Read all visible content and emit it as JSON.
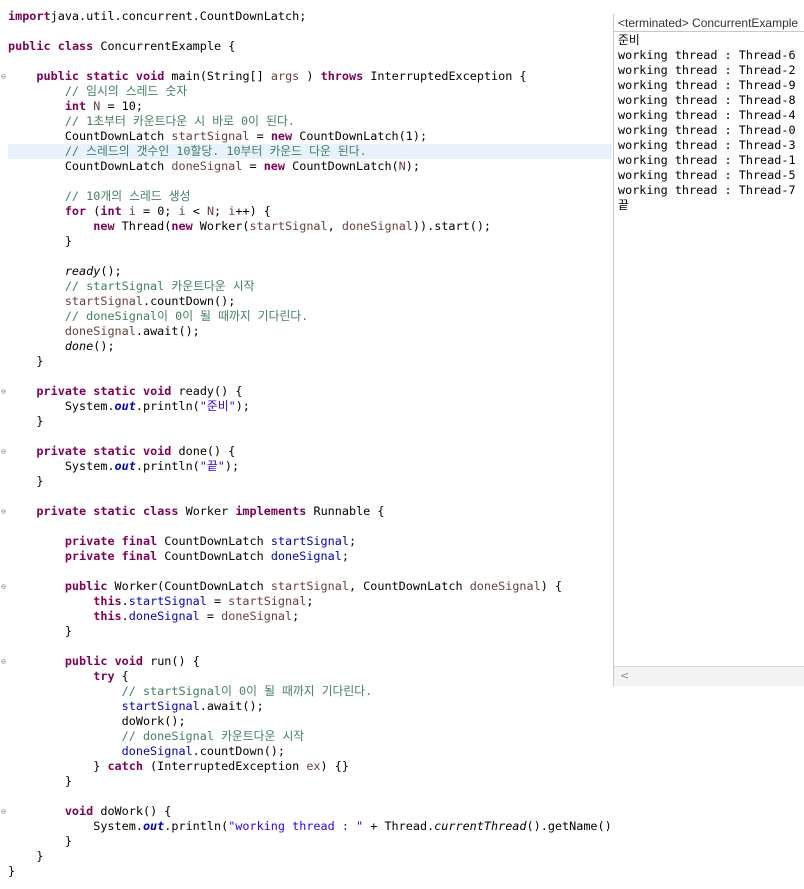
{
  "editor": {
    "lines": [
      [
        [
          "kw",
          "import"
        ],
        [
          "",
          "java.util.concurrent.CountDownLatch;"
        ]
      ],
      [],
      [
        [
          "kw",
          "public"
        ],
        [
          "",
          " "
        ],
        [
          "kw",
          "class"
        ],
        [
          "",
          " ConcurrentExample {"
        ]
      ],
      [],
      [
        [
          "",
          "    "
        ],
        [
          "kw",
          "public"
        ],
        [
          "",
          " "
        ],
        [
          "kw",
          "static"
        ],
        [
          "",
          " "
        ],
        [
          "kw",
          "void"
        ],
        [
          "",
          " main(String[] "
        ],
        [
          "lv",
          "args"
        ],
        [
          "",
          " ) "
        ],
        [
          "kw",
          "throws"
        ],
        [
          "",
          " InterruptedException {"
        ]
      ],
      [
        [
          "",
          "        "
        ],
        [
          "cm",
          "// 임시의 스레드 숫자"
        ]
      ],
      [
        [
          "",
          "        "
        ],
        [
          "kw",
          "int"
        ],
        [
          "",
          " "
        ],
        [
          "lv",
          "N"
        ],
        [
          "",
          " = 10;"
        ]
      ],
      [
        [
          "",
          "        "
        ],
        [
          "cm",
          "// 1초부터 카운트다운 시 바로 0이 된다."
        ]
      ],
      [
        [
          "",
          "        CountDownLatch "
        ],
        [
          "lv",
          "startSignal"
        ],
        [
          "",
          " = "
        ],
        [
          "kw",
          "new"
        ],
        [
          "",
          " CountDownLatch(1);"
        ]
      ],
      [
        [
          "",
          "        "
        ],
        [
          "cm",
          "// 스레드의 갯수인 10할당. 10부터 카운드 다운 된다."
        ]
      ],
      [
        [
          "",
          "        CountDownLatch "
        ],
        [
          "lv",
          "doneSignal"
        ],
        [
          "",
          " = "
        ],
        [
          "kw",
          "new"
        ],
        [
          "",
          " CountDownLatch("
        ],
        [
          "lv",
          "N"
        ],
        [
          "",
          ");"
        ]
      ],
      [],
      [
        [
          "",
          "        "
        ],
        [
          "cm",
          "// 10개의 스레드 생성"
        ]
      ],
      [
        [
          "",
          "        "
        ],
        [
          "kw",
          "for"
        ],
        [
          "",
          " ("
        ],
        [
          "kw",
          "int"
        ],
        [
          "",
          " "
        ],
        [
          "lv",
          "i"
        ],
        [
          "",
          " = 0; "
        ],
        [
          "lv",
          "i"
        ],
        [
          "",
          " < "
        ],
        [
          "lv",
          "N"
        ],
        [
          "",
          "; "
        ],
        [
          "lv",
          "i"
        ],
        [
          "",
          "++) {"
        ]
      ],
      [
        [
          "",
          "            "
        ],
        [
          "kw",
          "new"
        ],
        [
          "",
          " Thread("
        ],
        [
          "kw",
          "new"
        ],
        [
          "",
          " Worker("
        ],
        [
          "lv",
          "startSignal"
        ],
        [
          "",
          ", "
        ],
        [
          "lv",
          "doneSignal"
        ],
        [
          "",
          ")).start();"
        ]
      ],
      [
        [
          "",
          "        }"
        ]
      ],
      [],
      [
        [
          "",
          "        "
        ],
        [
          "it",
          "ready"
        ],
        [
          "",
          "();"
        ]
      ],
      [
        [
          "",
          "        "
        ],
        [
          "cm",
          "// startSignal 카운트다운 시작"
        ]
      ],
      [
        [
          "",
          "        "
        ],
        [
          "lv",
          "startSignal"
        ],
        [
          "",
          ".countDown();"
        ]
      ],
      [
        [
          "",
          "        "
        ],
        [
          "cm",
          "// doneSignal이 0이 될 때까지 기다린다."
        ]
      ],
      [
        [
          "",
          "        "
        ],
        [
          "lv",
          "doneSignal"
        ],
        [
          "",
          ".await();"
        ]
      ],
      [
        [
          "",
          "        "
        ],
        [
          "it",
          "done"
        ],
        [
          "",
          "();"
        ]
      ],
      [
        [
          "",
          "    }"
        ]
      ],
      [],
      [
        [
          "",
          "    "
        ],
        [
          "kw",
          "private"
        ],
        [
          "",
          " "
        ],
        [
          "kw",
          "static"
        ],
        [
          "",
          " "
        ],
        [
          "kw",
          "void"
        ],
        [
          "",
          " ready() {"
        ]
      ],
      [
        [
          "",
          "        System."
        ],
        [
          "sfd",
          "out"
        ],
        [
          "",
          ".println("
        ],
        [
          "st",
          "\"준비\""
        ],
        [
          "",
          ");"
        ]
      ],
      [
        [
          "",
          "    }"
        ]
      ],
      [],
      [
        [
          "",
          "    "
        ],
        [
          "kw",
          "private"
        ],
        [
          "",
          " "
        ],
        [
          "kw",
          "static"
        ],
        [
          "",
          " "
        ],
        [
          "kw",
          "void"
        ],
        [
          "",
          " done() {"
        ]
      ],
      [
        [
          "",
          "        System."
        ],
        [
          "sfd",
          "out"
        ],
        [
          "",
          ".println("
        ],
        [
          "st",
          "\"끝\""
        ],
        [
          "",
          ");"
        ]
      ],
      [
        [
          "",
          "    }"
        ]
      ],
      [],
      [
        [
          "",
          "    "
        ],
        [
          "kw",
          "private"
        ],
        [
          "",
          " "
        ],
        [
          "kw",
          "static"
        ],
        [
          "",
          " "
        ],
        [
          "kw",
          "class"
        ],
        [
          "",
          " Worker "
        ],
        [
          "kw",
          "implements"
        ],
        [
          "",
          " Runnable {"
        ]
      ],
      [],
      [
        [
          "",
          "        "
        ],
        [
          "kw",
          "private"
        ],
        [
          "",
          " "
        ],
        [
          "kw",
          "final"
        ],
        [
          "",
          " CountDownLatch "
        ],
        [
          "fd",
          "startSignal"
        ],
        [
          "",
          ";"
        ]
      ],
      [
        [
          "",
          "        "
        ],
        [
          "kw",
          "private"
        ],
        [
          "",
          " "
        ],
        [
          "kw",
          "final"
        ],
        [
          "",
          " CountDownLatch "
        ],
        [
          "fd",
          "doneSignal"
        ],
        [
          "",
          ";"
        ]
      ],
      [],
      [
        [
          "",
          "        "
        ],
        [
          "kw",
          "public"
        ],
        [
          "",
          " Worker(CountDownLatch "
        ],
        [
          "lv",
          "startSignal"
        ],
        [
          "",
          ", CountDownLatch "
        ],
        [
          "lv",
          "doneSignal"
        ],
        [
          "",
          ") {"
        ]
      ],
      [
        [
          "",
          "            "
        ],
        [
          "kw",
          "this"
        ],
        [
          "",
          "."
        ],
        [
          "fd",
          "startSignal"
        ],
        [
          "",
          " = "
        ],
        [
          "lv",
          "startSignal"
        ],
        [
          "",
          ";"
        ]
      ],
      [
        [
          "",
          "            "
        ],
        [
          "kw",
          "this"
        ],
        [
          "",
          "."
        ],
        [
          "fd",
          "doneSignal"
        ],
        [
          "",
          " = "
        ],
        [
          "lv",
          "doneSignal"
        ],
        [
          "",
          ";"
        ]
      ],
      [
        [
          "",
          "        }"
        ]
      ],
      [],
      [
        [
          "",
          "        "
        ],
        [
          "kw",
          "public"
        ],
        [
          "",
          " "
        ],
        [
          "kw",
          "void"
        ],
        [
          "",
          " run() {"
        ]
      ],
      [
        [
          "",
          "            "
        ],
        [
          "kw",
          "try"
        ],
        [
          "",
          " {"
        ]
      ],
      [
        [
          "",
          "                "
        ],
        [
          "cm",
          "// startSignal이 0이 될 때까지 기다린다."
        ]
      ],
      [
        [
          "",
          "                "
        ],
        [
          "fd",
          "startSignal"
        ],
        [
          "",
          ".await();"
        ]
      ],
      [
        [
          "",
          "                doWork();"
        ]
      ],
      [
        [
          "",
          "                "
        ],
        [
          "cm",
          "// doneSignal 카운트다운 시작"
        ]
      ],
      [
        [
          "",
          "                "
        ],
        [
          "fd",
          "doneSignal"
        ],
        [
          "",
          ".countDown();"
        ]
      ],
      [
        [
          "",
          "            } "
        ],
        [
          "kw",
          "catch"
        ],
        [
          "",
          " (InterruptedException "
        ],
        [
          "lv",
          "ex"
        ],
        [
          "",
          ") {}"
        ]
      ],
      [
        [
          "",
          "        }"
        ]
      ],
      [],
      [
        [
          "",
          "        "
        ],
        [
          "kw",
          "void"
        ],
        [
          "",
          " doWork() {"
        ]
      ],
      [
        [
          "",
          "            System."
        ],
        [
          "sfd",
          "out"
        ],
        [
          "",
          ".println("
        ],
        [
          "st",
          "\"working thread : \""
        ],
        [
          "",
          " + Thread."
        ],
        [
          "it",
          "currentThread"
        ],
        [
          "",
          "().getName());"
        ]
      ],
      [
        [
          "",
          "        }"
        ]
      ],
      [
        [
          "",
          "    }"
        ]
      ],
      [
        [
          "",
          "}"
        ]
      ]
    ],
    "highlighted_line": 9,
    "fold_markers": [
      4,
      25,
      29,
      33,
      38,
      43,
      53
    ]
  },
  "console": {
    "title": "<terminated> ConcurrentExample",
    "output": [
      "준비",
      "working thread : Thread-6",
      "working thread : Thread-2",
      "working thread : Thread-9",
      "working thread : Thread-8",
      "working thread : Thread-4",
      "working thread : Thread-0",
      "working thread : Thread-3",
      "working thread : Thread-1",
      "working thread : Thread-5",
      "working thread : Thread-7",
      "끝"
    ],
    "scroll_left_icon": "chevron-left-icon"
  },
  "colors": {
    "keyword": "#7f0055",
    "comment": "#3f7f5f",
    "string": "#2a00ff",
    "field": "#0000c0",
    "local_variable": "#6a3e3e",
    "current_line_highlight": "#e8f2fe"
  }
}
